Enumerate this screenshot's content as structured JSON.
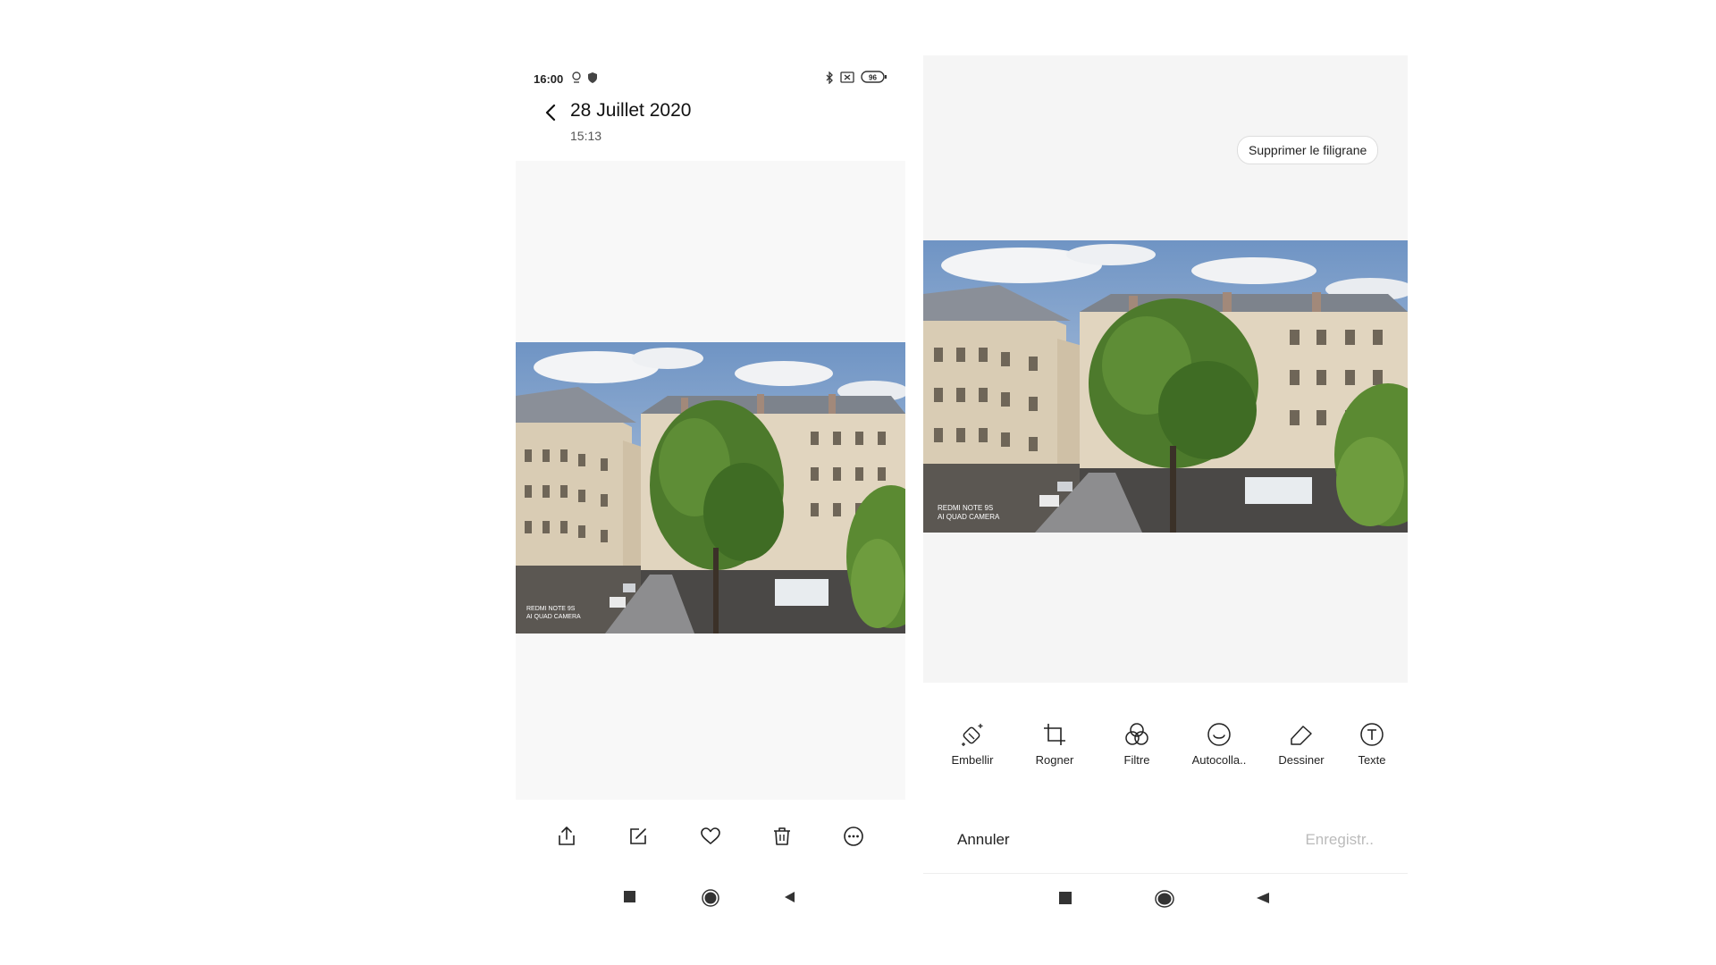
{
  "left": {
    "status": {
      "time": "16:00",
      "battery": "96"
    },
    "header": {
      "title": "28 Juillet 2020",
      "subtitle": "15:13"
    },
    "watermark": {
      "line1": "REDMI NOTE 9S",
      "line2": "AI QUAD CAMERA"
    },
    "actions": [
      "share-icon",
      "edit-icon",
      "heart-icon",
      "trash-icon",
      "more-icon"
    ]
  },
  "right": {
    "remove_watermark_label": "Supprimer le filigrane",
    "watermark": {
      "line1": "REDMI NOTE 9S",
      "line2": "AI QUAD CAMERA"
    },
    "tools": [
      {
        "icon": "beautify-icon",
        "label": "Embellir"
      },
      {
        "icon": "crop-icon",
        "label": "Rogner"
      },
      {
        "icon": "filter-icon",
        "label": "Filtre"
      },
      {
        "icon": "sticker-icon",
        "label": "Autocolla.."
      },
      {
        "icon": "draw-icon",
        "label": "Dessiner"
      },
      {
        "icon": "text-icon",
        "label": "Texte"
      }
    ],
    "cancel_label": "Annuler",
    "save_label": "Enregistr.."
  },
  "nav": [
    "recents-button",
    "home-button",
    "back-button"
  ]
}
